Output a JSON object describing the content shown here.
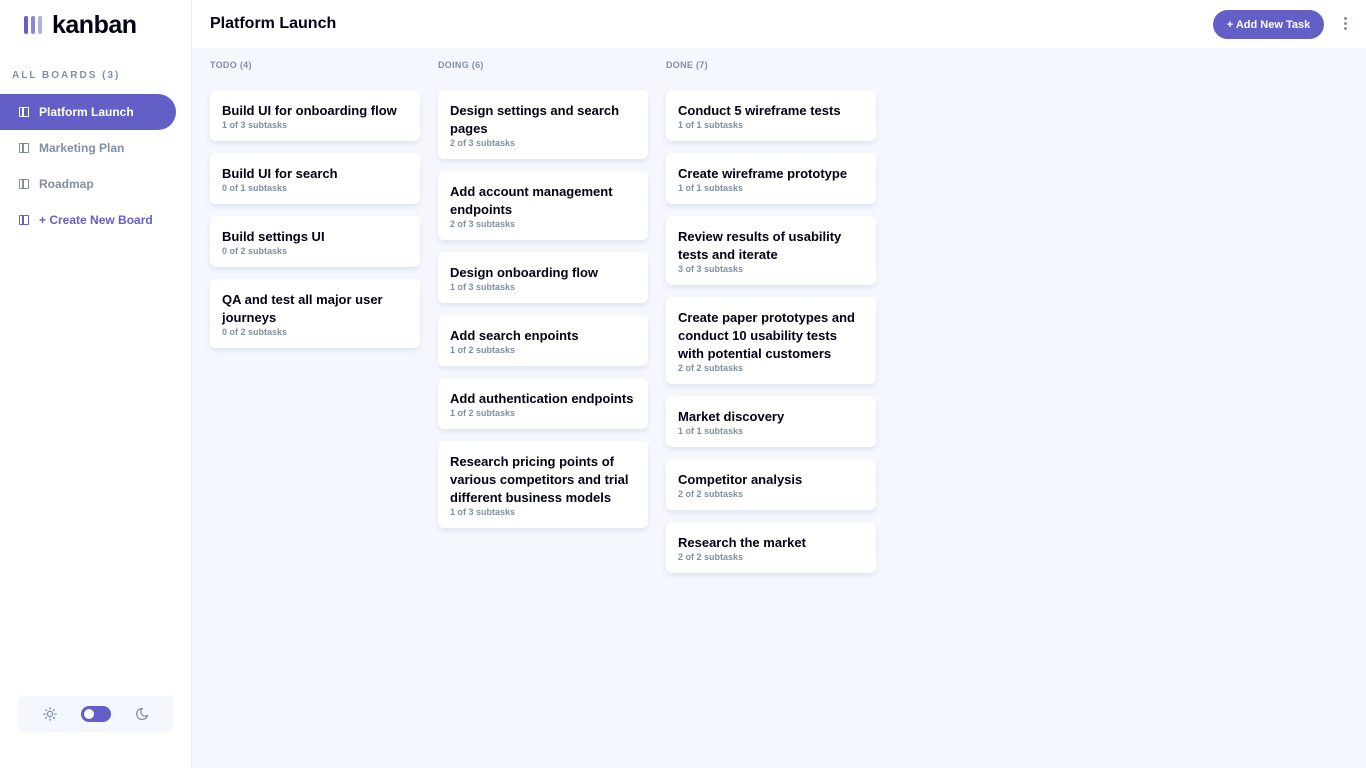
{
  "app": {
    "logo_text": "kanban",
    "accent": "#635fc7"
  },
  "sidebar": {
    "all_boards_label": "ALL BOARDS (3)",
    "boards": [
      {
        "label": "Platform Launch",
        "active": true
      },
      {
        "label": "Marketing Plan",
        "active": false
      },
      {
        "label": "Roadmap",
        "active": false
      }
    ],
    "create_label": "+ Create New Board",
    "theme": {
      "light_icon": "sun-icon",
      "dark_icon": "moon-icon",
      "mode": "light"
    }
  },
  "header": {
    "title": "Platform Launch",
    "add_task_label": "+ Add New Task",
    "menu_icon": "vertical-ellipsis-icon"
  },
  "columns": [
    {
      "title": "TODO (4)",
      "tasks": [
        {
          "title": "Build UI for onboarding flow",
          "subtasks": "1 of 3 subtasks"
        },
        {
          "title": "Build UI for search",
          "subtasks": "0 of 1 subtasks"
        },
        {
          "title": "Build settings UI",
          "subtasks": "0 of 2 subtasks"
        },
        {
          "title": "QA and test all major user journeys",
          "subtasks": "0 of 2 subtasks"
        }
      ]
    },
    {
      "title": "DOING (6)",
      "tasks": [
        {
          "title": "Design settings and search pages",
          "subtasks": "2 of 3 subtasks"
        },
        {
          "title": "Add account management endpoints",
          "subtasks": "2 of 3 subtasks"
        },
        {
          "title": "Design onboarding flow",
          "subtasks": "1 of 3 subtasks"
        },
        {
          "title": "Add search enpoints",
          "subtasks": "1 of 2 subtasks"
        },
        {
          "title": "Add authentication endpoints",
          "subtasks": "1 of 2 subtasks"
        },
        {
          "title": "Research pricing points of various competitors and trial different business models",
          "subtasks": "1 of 3 subtasks"
        }
      ]
    },
    {
      "title": "DONE (7)",
      "tasks": [
        {
          "title": "Conduct 5 wireframe tests",
          "subtasks": "1 of 1 subtasks"
        },
        {
          "title": "Create wireframe prototype",
          "subtasks": "1 of 1 subtasks"
        },
        {
          "title": "Review results of usability tests and iterate",
          "subtasks": "3 of 3 subtasks"
        },
        {
          "title": "Create paper prototypes and conduct 10 usability tests with potential customers",
          "subtasks": "2 of 2 subtasks"
        },
        {
          "title": "Market discovery",
          "subtasks": "1 of 1 subtasks"
        },
        {
          "title": "Competitor analysis",
          "subtasks": "2 of 2 subtasks"
        },
        {
          "title": "Research the market",
          "subtasks": "2 of 2 subtasks"
        }
      ]
    }
  ]
}
